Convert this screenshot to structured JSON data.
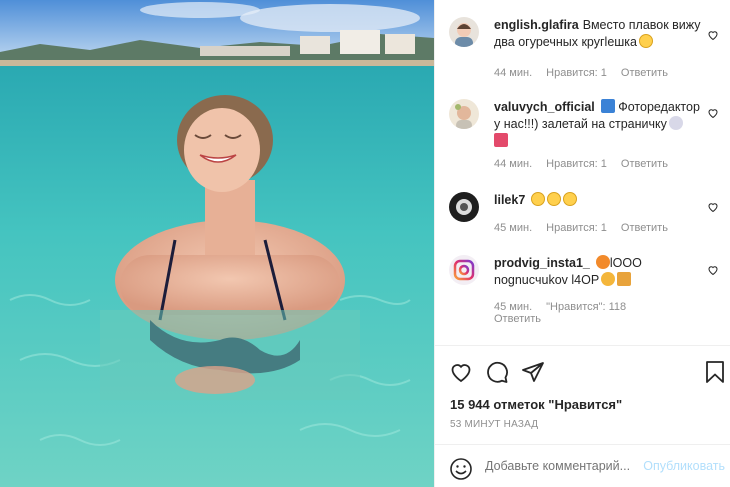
{
  "comments": [
    {
      "username": "english.glafira",
      "text": "Вместо плавок вижу два огуречных кругleшка",
      "time": "44 мин.",
      "likes": "Нравится: 1",
      "reply": "Ответить"
    },
    {
      "username": "valuvych_official",
      "text": "Фоторедактор у нас!!!) залетай на страничку",
      "time": "44 мин.",
      "likes": "Нравится: 1",
      "reply": "Ответить"
    },
    {
      "username": "lilek7",
      "text": "",
      "time": "45 мин.",
      "likes": "Нравится: 1",
      "reply": "Ответить"
    },
    {
      "username": "prodvig_insta1_",
      "text": "lOOO nognucчukov l4OP",
      "time": "45 мин.",
      "likes": "\"Нравится\": 118",
      "reply": "Ответить"
    }
  ],
  "likes_count": "15 944 отметок \"Нравится\"",
  "posted_time": "53 МИНУТ НАЗАД",
  "add_comment": {
    "placeholder": "Добавьте комментарий...",
    "publish": "Опубликовать"
  },
  "icons": [
    "heart-icon",
    "comment-icon",
    "share-icon",
    "bookmark-icon",
    "emoji-icon"
  ],
  "colors": {
    "link_blue_disabled": "#b2dffc",
    "meta_gray": "#8e8e8e",
    "text": "#262626"
  }
}
